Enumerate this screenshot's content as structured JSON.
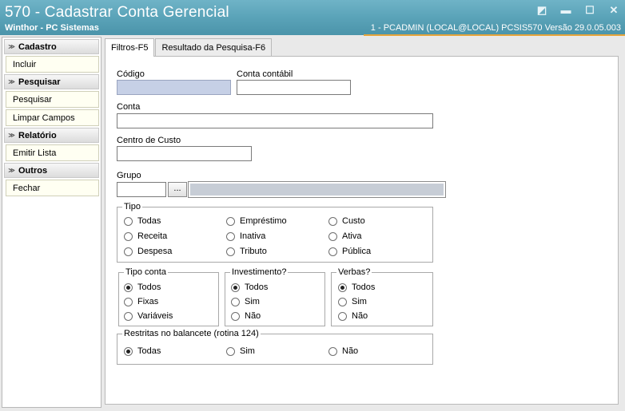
{
  "window": {
    "title": "570 - Cadastrar Conta Gerencial",
    "subtitle": "Winthor - PC Sistemas",
    "session_info": "1 - PCADMIN (LOCAL@LOCAL)   PCSIS570  Versão  29.0.05.003",
    "controls": {
      "restore_glyph": "◩",
      "minimize_glyph": "▬",
      "maximize_glyph": "☐",
      "close_glyph": "✕"
    }
  },
  "sidebar": {
    "sections": [
      {
        "title": "Cadastro",
        "items": [
          "Incluir"
        ]
      },
      {
        "title": "Pesquisar",
        "items": [
          "Pesquisar",
          "Limpar Campos"
        ]
      },
      {
        "title": "Relatório",
        "items": [
          "Emitir Lista"
        ]
      },
      {
        "title": "Outros",
        "items": [
          "Fechar"
        ]
      }
    ],
    "chevron_glyph": "≫"
  },
  "tabs": [
    {
      "label": "Filtros-F5",
      "active": true
    },
    {
      "label": "Resultado da Pesquisa-F6",
      "active": false
    }
  ],
  "form": {
    "codigo_label": "Código",
    "codigo_value": "",
    "conta_contabil_label": "Conta contábil",
    "conta_contabil_value": "",
    "conta_label": "Conta",
    "conta_value": "",
    "centro_custo_label": "Centro de Custo",
    "centro_custo_value": "",
    "grupo_label": "Grupo",
    "grupo_value": "",
    "grupo_desc_value": "",
    "grupo_button": "..."
  },
  "tipo": {
    "legend": "Tipo",
    "options": [
      "Todas",
      "Empréstimo",
      "Custo",
      "Receita",
      "Inativa",
      "Ativa",
      "Despesa",
      "Tributo",
      "Pública"
    ]
  },
  "tipo_conta": {
    "legend": "Tipo conta",
    "options": [
      "Todos",
      "Fixas",
      "Variáveis"
    ],
    "selected": "Todos"
  },
  "investimento": {
    "legend": "Investimento?",
    "options": [
      "Todos",
      "Sim",
      "Não"
    ],
    "selected": "Todos"
  },
  "verbas": {
    "legend": "Verbas?",
    "options": [
      "Todos",
      "Sim",
      "Não"
    ],
    "selected": "Todos"
  },
  "restritas": {
    "legend": "Restritas no balancete (rotina 124)",
    "options": [
      "Todas",
      "Sim",
      "Não"
    ],
    "selected": "Todas"
  }
}
